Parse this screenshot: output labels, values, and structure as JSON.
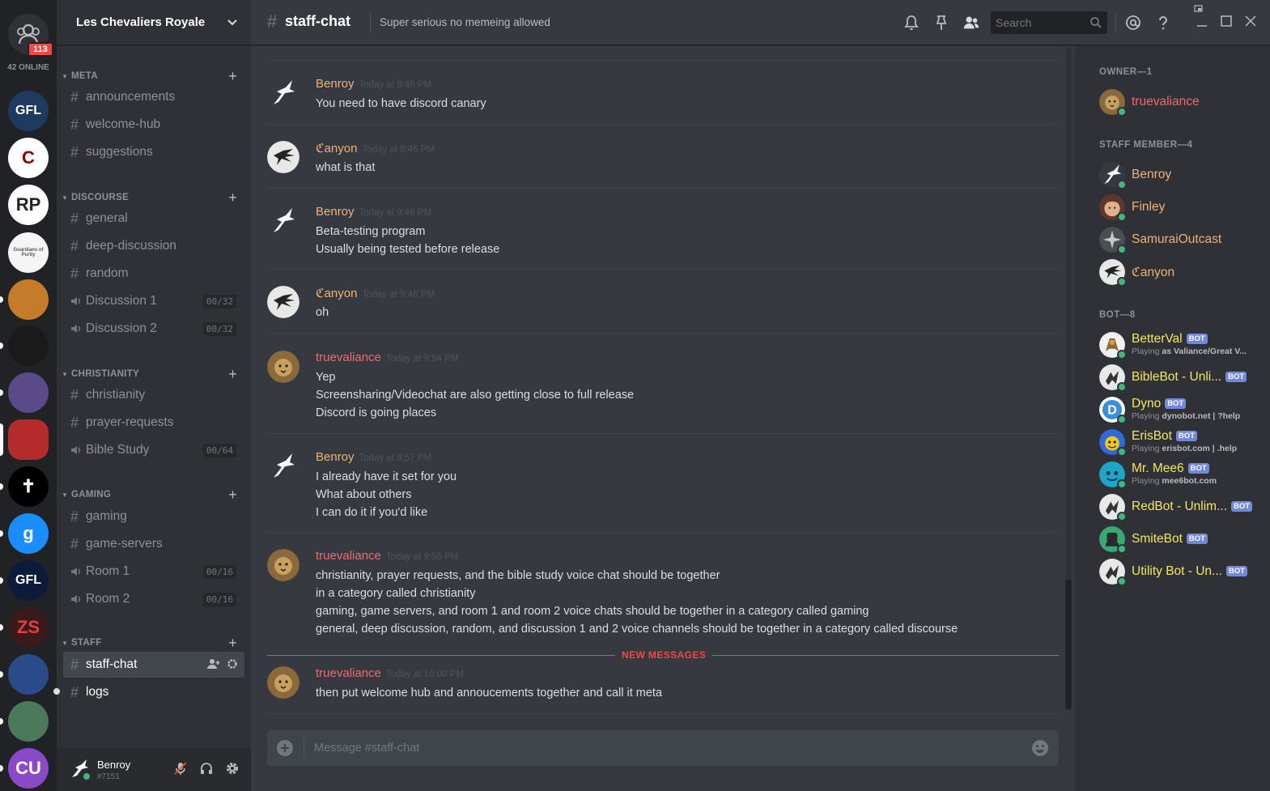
{
  "guilds": {
    "home_badge": "113",
    "online_count": "42 ONLINE",
    "list": [
      {
        "label": "GFL",
        "bg": "#1e3a5f",
        "fg": "#ffffff"
      },
      {
        "label": "C",
        "bg": "#ffffff",
        "fg": "#8b0000"
      },
      {
        "label": "RP",
        "bg": "#ffffff",
        "fg": "#222222"
      },
      {
        "label": "Guardians of Purity",
        "bg": "#f5f5f5",
        "fg": "#555555"
      },
      {
        "label": "",
        "bg": "#c47b2a",
        "fg": "#ffffff"
      },
      {
        "label": "",
        "bg": "#1a1a1a",
        "fg": "#dddddd"
      },
      {
        "label": "",
        "bg": "#5a4a8a",
        "fg": "#ffffff"
      },
      {
        "label": "",
        "bg": "#b52a2a",
        "fg": "#ffffff"
      },
      {
        "label": "✝",
        "bg": "#000000",
        "fg": "#ffffff"
      },
      {
        "label": "g",
        "bg": "#1a8dff",
        "fg": "#ffffff"
      },
      {
        "label": "GFL",
        "bg": "#0d1b3a",
        "fg": "#ffffff"
      },
      {
        "label": "ZS",
        "bg": "#3a1a1a",
        "fg": "#e04040"
      },
      {
        "label": "",
        "bg": "#2a4a8a",
        "fg": "#ffffff"
      },
      {
        "label": "",
        "bg": "#4a7a5a",
        "fg": "#ffffff"
      },
      {
        "label": "CU",
        "bg": "#8a4ac8",
        "fg": "#ffffff"
      }
    ]
  },
  "server": {
    "name": "Les Chevaliers Royale"
  },
  "categories": [
    {
      "name": "META"
    },
    {
      "name": "DISCOURSE"
    },
    {
      "name": "CHRISTIANITY"
    },
    {
      "name": "GAMING"
    },
    {
      "name": "STAFF"
    }
  ],
  "channels": {
    "meta": [
      {
        "name": "announcements",
        "type": "text"
      },
      {
        "name": "welcome-hub",
        "type": "text"
      },
      {
        "name": "suggestions",
        "type": "text"
      }
    ],
    "discourse": [
      {
        "name": "general",
        "type": "text"
      },
      {
        "name": "deep-discussion",
        "type": "text"
      },
      {
        "name": "random",
        "type": "text"
      },
      {
        "name": "Discussion 1",
        "type": "voice",
        "count": "00/32"
      },
      {
        "name": "Discussion 2",
        "type": "voice",
        "count": "00/32"
      }
    ],
    "christianity": [
      {
        "name": "christianity",
        "type": "text"
      },
      {
        "name": "prayer-requests",
        "type": "text"
      },
      {
        "name": "Bible Study",
        "type": "voice",
        "count": "00/64"
      }
    ],
    "gaming": [
      {
        "name": "gaming",
        "type": "text"
      },
      {
        "name": "game-servers",
        "type": "text"
      },
      {
        "name": "Room 1",
        "type": "voice",
        "count": "00/16"
      },
      {
        "name": "Room 2",
        "type": "voice",
        "count": "00/16"
      }
    ],
    "staff": [
      {
        "name": "staff-chat",
        "type": "text",
        "active": true
      },
      {
        "name": "logs",
        "type": "text",
        "unread": true
      }
    ]
  },
  "user": {
    "name": "Benroy",
    "discriminator": "#7151"
  },
  "topbar": {
    "channel": "staff-chat",
    "topic": "Super serious no memeing allowed",
    "search_placeholder": "Search"
  },
  "messages": [
    {
      "author": "Benroy",
      "color": "#f0b27a",
      "time": "Today at 9:45 PM",
      "avatar": "bird",
      "lines": [
        "You need to have discord canary"
      ]
    },
    {
      "author": "ℭanyon",
      "color": "#f0b27a",
      "time": "Today at 9:46 PM",
      "avatar": "canyon",
      "lines": [
        "what is that"
      ]
    },
    {
      "author": "Benroy",
      "color": "#f0b27a",
      "time": "Today at 9:46 PM",
      "avatar": "bird",
      "lines": [
        "Beta-testing program",
        "Usually being tested before release"
      ]
    },
    {
      "author": "ℭanyon",
      "color": "#f0b27a",
      "time": "Today at 9:46 PM",
      "avatar": "canyon",
      "lines": [
        "oh"
      ]
    },
    {
      "author": "truevaliance",
      "color": "#f26b6b",
      "time": "Today at 9:54 PM",
      "avatar": "lion",
      "lines": [
        "Yep",
        "Screensharing/Videochat are also getting close to full release",
        "Discord is going places"
      ]
    },
    {
      "author": "Benroy",
      "color": "#f0b27a",
      "time": "Today at 9:57 PM",
      "avatar": "bird",
      "lines": [
        "I already have it set for you",
        "What about others",
        "I can do it if you'd like"
      ]
    },
    {
      "author": "truevaliance",
      "color": "#f26b6b",
      "time": "Today at 9:58 PM",
      "avatar": "lion",
      "lines": [
        "christianity, prayer requests, and the bible study voice chat should be together",
        "in a category called christianity",
        "gaming, game servers, and room 1 and room 2 voice chats should be together in a category called gaming",
        "general, deep discussion, random, and discussion 1 and 2 voice channels should be together in a category called discourse"
      ]
    },
    {
      "author": "truevaliance",
      "color": "#f26b6b",
      "time": "Today at 10:00 PM",
      "avatar": "lion",
      "lines": [
        "then put welcome hub and annoucements together and call it meta"
      ]
    }
  ],
  "new_messages_label": "NEW MESSAGES",
  "composer": {
    "placeholder": "Message #staff-chat"
  },
  "members": {
    "groups": [
      {
        "title": "OWNER—1",
        "members": [
          {
            "name": "truevaliance",
            "color": "#f26b6b",
            "avatar": "lion"
          }
        ]
      },
      {
        "title": "STAFF MEMBER—4",
        "members": [
          {
            "name": "Benroy",
            "color": "#f0b27a",
            "avatar": "bird"
          },
          {
            "name": "Finley",
            "color": "#f0b27a",
            "avatar": "face"
          },
          {
            "name": "SamuraiOutcast",
            "color": "#f0b27a",
            "avatar": "samurai"
          },
          {
            "name": "ℭanyon",
            "color": "#f0b27a",
            "avatar": "canyon"
          }
        ]
      },
      {
        "title": "BOT—8",
        "members": [
          {
            "name": "BetterVal",
            "color": "#f5e663",
            "avatar": "betterval",
            "bot": true,
            "playing": "as Valiance/Great V..."
          },
          {
            "name": "BibleBot - Unli...",
            "color": "#f5e663",
            "avatar": "botgeneric",
            "bot": true
          },
          {
            "name": "Dyno",
            "color": "#f5e663",
            "avatar": "dyno",
            "bot": true,
            "playing": "dynobot.net | ?help"
          },
          {
            "name": "ErisBot",
            "color": "#f5e663",
            "avatar": "eris",
            "bot": true,
            "playing": "erisbot.com | .help"
          },
          {
            "name": "Mr. Mee6",
            "color": "#f5e663",
            "avatar": "mee6",
            "bot": true,
            "playing": "mee6bot.com"
          },
          {
            "name": "RedBot - Unlim...",
            "color": "#f5e663",
            "avatar": "botgeneric",
            "bot": true
          },
          {
            "name": "SmiteBot",
            "color": "#f5e663",
            "avatar": "smite",
            "bot": true
          },
          {
            "name": "Utility Bot - Un...",
            "color": "#f5e663",
            "avatar": "botgeneric",
            "bot": true
          }
        ]
      }
    ],
    "playing_prefix": "Playing",
    "bot_tag": "BOT"
  }
}
